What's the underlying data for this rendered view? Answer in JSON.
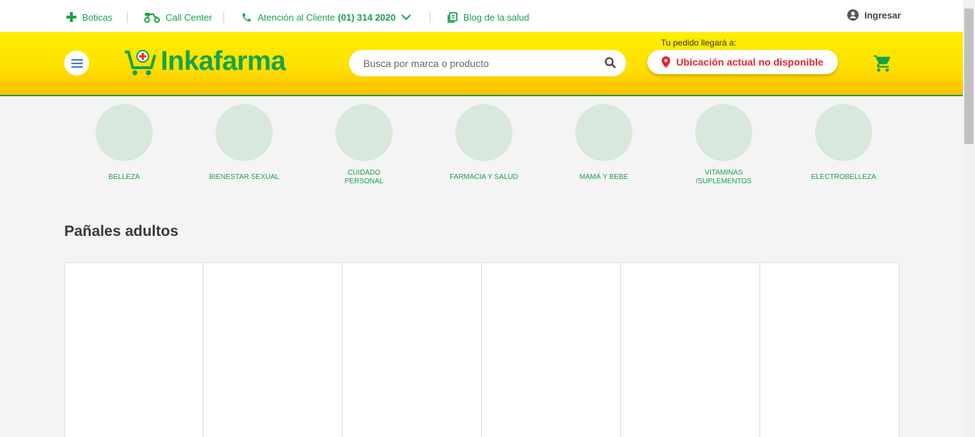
{
  "topbar": {
    "boticas": "Boticas",
    "call_center": "Call Center",
    "atencion_label": "Atención al Cliente",
    "atencion_phone": "(01) 314 2020",
    "blog": "Blog de la salud",
    "login": "Ingresar"
  },
  "header": {
    "logo_text": "Inkafarma",
    "search_placeholder": "Busca por marca o producto",
    "delivery_label": "Tu pedido llegará a:",
    "location_text": "Ubicación actual no disponible"
  },
  "categories": [
    {
      "label": "BELLEZA"
    },
    {
      "label": "BIENESTAR SEXUAL"
    },
    {
      "label": "CUIDADO PERSONAL"
    },
    {
      "label": "FARMACIA Y SALUD"
    },
    {
      "label": "MAMÁ Y BEBE"
    },
    {
      "label": "VITAMINAS /SUPLEMENTOS"
    },
    {
      "label": "ELECTROBELLEZA"
    }
  ],
  "section": {
    "title": "Pañales adultos"
  },
  "colors": {
    "brand_green": "#17a34a",
    "brand_yellow": "#ffe100",
    "alert_red": "#e8232f"
  }
}
